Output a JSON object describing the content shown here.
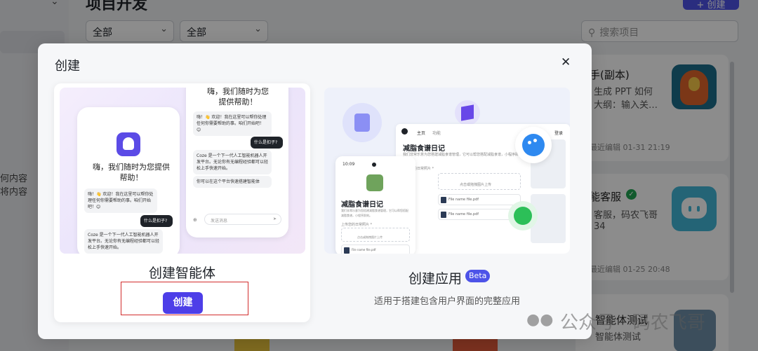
{
  "background": {
    "page_title": "项目开发",
    "create_button": "+ 创建",
    "filter1": "全部",
    "filter2": "全部",
    "search_placeholder": "搜索项目",
    "left_text1": "何内容",
    "left_text2": "将内容",
    "card1": {
      "title": "手(副本)",
      "line1": "生成 PPT 如何",
      "line2": "大纲：输入关…",
      "date": "最近编辑 01-31 21:19"
    },
    "card2": {
      "title": "能客服",
      "line1": "客服，码农飞哥",
      "line2": "34",
      "date": "最近编辑 01-25 20:48"
    },
    "card3": {
      "title": "智能体测试",
      "subtitle": "智能体测试"
    }
  },
  "modal": {
    "title": "创建",
    "close": "✕",
    "agent_option": {
      "title": "创建智能体",
      "button": "创建",
      "preview": {
        "greeting": "嗨，我们随时为您提供帮助！",
        "top_greeting_line1": "嗨，我们随时为您",
        "top_greeting_line2": "提供帮助！",
        "welcome_msg": "嗨！👋 欢迎！我在这里可以帮你处理任何你需要帮助的事。咱们开始吧！😊",
        "user_msg": "什么是扣子?",
        "bot_reply": "Coze 是一个下一代人工智能机器人开发平台。无论你有无编程经验都可以轻松上手快速开始。",
        "bot_reply2": "你可以在这个平台快速搭建智能体",
        "input_placeholder": "发送消息"
      }
    },
    "app_option": {
      "title": "创建应用",
      "badge": "Beta",
      "desc": "适用于搭建包含用户界面的完整应用",
      "preview": {
        "app_name": "减脂食谱日记",
        "time": "10:09",
        "nav_home": "主页",
        "nav_other": "功能",
        "nav_login": "登录",
        "desc": "我们非常乐意为您搭建减脂食谱管理，它可以帮您搭配减脂食谱，小程序即刻。",
        "upload_label": "上传您的日常照片 *",
        "upload_hint": "点击或拖拽图片上传",
        "file1": "File name file.pdf",
        "file2": "File name file.pdf",
        "file3": "File name file.pdf"
      }
    }
  },
  "watermark": {
    "text": "公众号 · 码农飞哥"
  }
}
